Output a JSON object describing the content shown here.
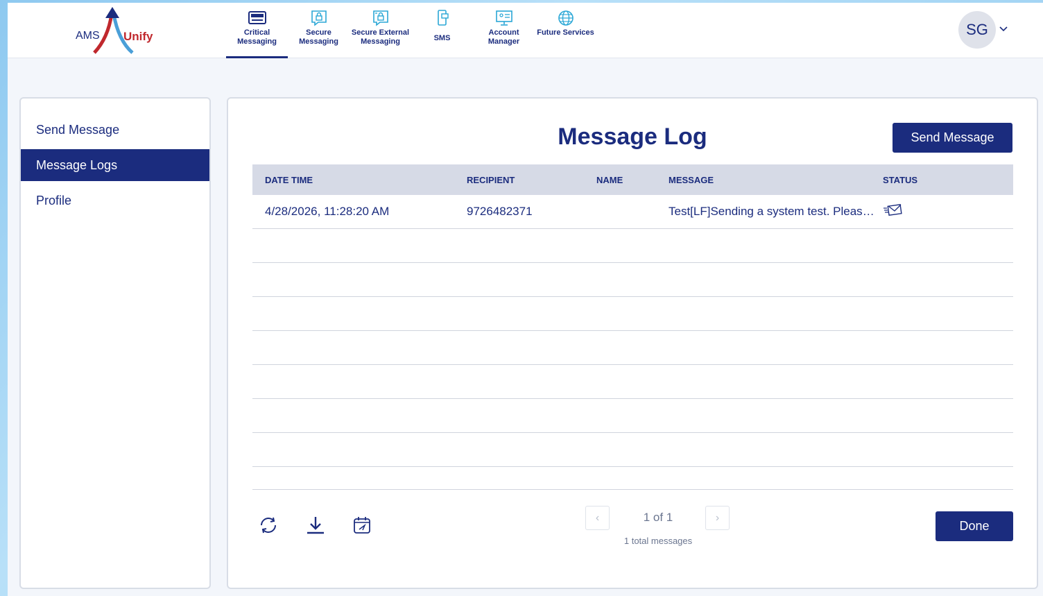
{
  "header": {
    "logo": {
      "left_text": "AMS",
      "right_text": "Unify"
    },
    "nav": [
      {
        "label": "Critical Messaging",
        "icon": "pager-icon",
        "active": true
      },
      {
        "label": "Secure Messaging",
        "icon": "chat-lock-icon"
      },
      {
        "label": "Secure External Messaging",
        "icon": "chat-lock-external-icon"
      },
      {
        "label": "SMS",
        "icon": "mobile-phone-icon"
      },
      {
        "label": "Account Manager",
        "icon": "monitor-user-icon"
      },
      {
        "label": "Future Services",
        "icon": "globe-icon"
      }
    ],
    "user_initials": "SG"
  },
  "sidebar": {
    "items": [
      {
        "label": "Send Message"
      },
      {
        "label": "Message Logs",
        "active": true
      },
      {
        "label": "Profile"
      }
    ]
  },
  "main": {
    "title": "Message Log",
    "send_button": "Send Message",
    "table": {
      "columns": [
        "DATE TIME",
        "RECIPIENT",
        "NAME",
        "MESSAGE",
        "STATUS"
      ],
      "rows": [
        {
          "datetime": "4/28/2026, 11:28:20 AM",
          "recipient": "9726482371",
          "name": "",
          "message": "Test[LF]Sending a system test. Please ignore.",
          "status_icon": "sent-envelope-icon"
        }
      ],
      "empty_rows": 7
    },
    "tools": [
      "refresh-icon",
      "download-icon",
      "calendar-icon"
    ],
    "pager": {
      "prev": "‹",
      "next": "›",
      "text": "1 of 1",
      "total": "1 total messages"
    },
    "done_button": "Done"
  },
  "colors": {
    "brand": "#1b2c7e",
    "accent_red": "#c0282d",
    "icon_cyan": "#2aa7d6"
  }
}
